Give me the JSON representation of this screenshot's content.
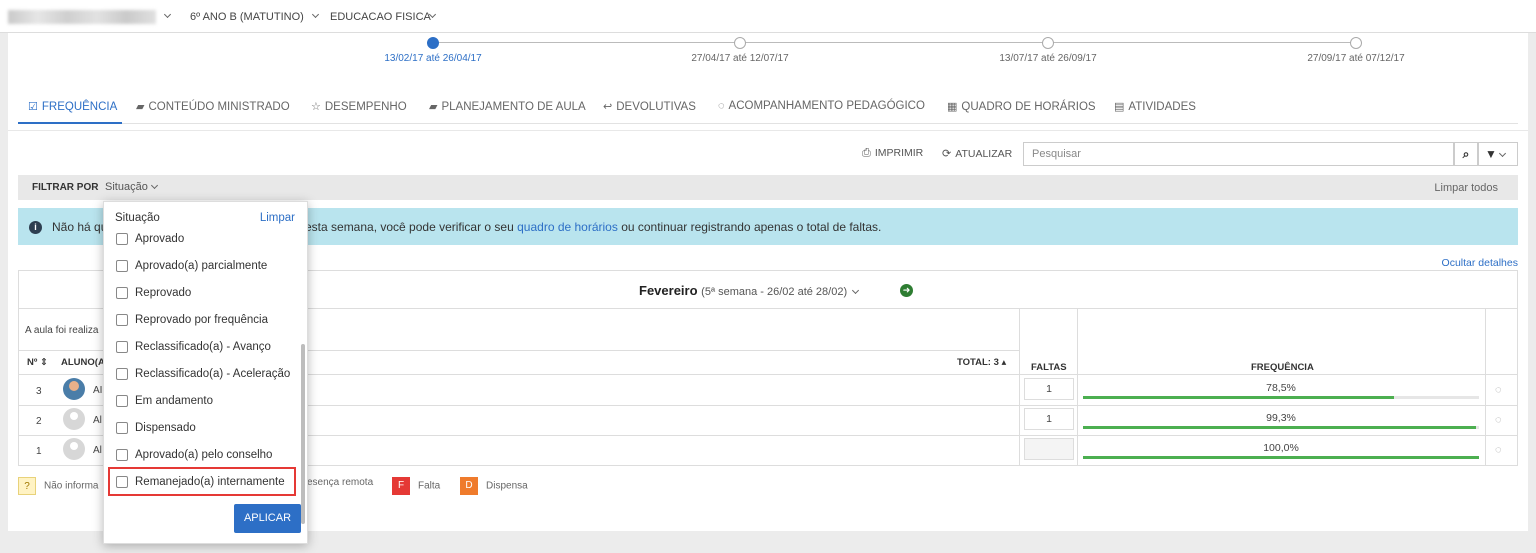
{
  "topbar": {
    "school_select": "6º ANO B (MATUTINO)",
    "subject_select": "EDUCACAO FISICA"
  },
  "timeline": [
    {
      "label": "13/02/17 até 26/04/17",
      "active": true
    },
    {
      "label": "27/04/17 até 12/07/17",
      "active": false
    },
    {
      "label": "13/07/17 até 26/09/17",
      "active": false
    },
    {
      "label": "27/09/17 até 07/12/17",
      "active": false
    }
  ],
  "tabs": [
    {
      "label": "FREQUÊNCIA",
      "icon": "check-square-icon"
    },
    {
      "label": "CONTEÚDO MINISTRADO",
      "icon": "book-icon"
    },
    {
      "label": "DESEMPENHO",
      "icon": "star-icon"
    },
    {
      "label": "PLANEJAMENTO DE AULA",
      "icon": "book-icon"
    },
    {
      "label": "DEVOLUTIVAS",
      "icon": "reply-icon"
    },
    {
      "label": "ACOMPANHAMENTO PEDAGÓGICO",
      "icon": "comment-icon"
    },
    {
      "label": "QUADRO DE HORÁRIOS",
      "icon": "calendar-icon"
    },
    {
      "label": "ATIVIDADES",
      "icon": "file-icon"
    }
  ],
  "toolbar": {
    "print": "IMPRIMIR",
    "refresh": "ATUALIZAR",
    "search_placeholder": "Pesquisar"
  },
  "filter": {
    "label": "FILTRAR POR",
    "situation": "Situação",
    "clear_all": "Limpar todos"
  },
  "info": {
    "prefix": "Não há qu",
    "text_before": "esta semana, você pode verificar o seu ",
    "link": "quadro de horários",
    "text_after": " ou continuar registrando apenas o total de faltas."
  },
  "hide_details": "Ocultar detalhes",
  "table": {
    "month": "Fevereiro",
    "week": "(5ª semana - 26/02 até 28/02)",
    "aula_text": "A aula foi realiza",
    "col_n": "Nº",
    "col_student": "ALUNO(A",
    "total": "TOTAL: 3",
    "col_faltas": "FALTAS",
    "col_freq": "FREQUÊNCIA",
    "rows": [
      {
        "n": "3",
        "name": "AI",
        "faltas": "1",
        "freq": "78,5%",
        "freq_value": 0.785,
        "avatar": "photo"
      },
      {
        "n": "2",
        "name": "Al",
        "faltas": "1",
        "freq": "99,3%",
        "freq_value": 0.993,
        "avatar": "generic"
      },
      {
        "n": "1",
        "name": "Al",
        "faltas": "",
        "freq": "100,0%",
        "freq_value": 1.0,
        "avatar": "generic"
      }
    ]
  },
  "legend": [
    {
      "code": "?",
      "label": "Não informa",
      "color": "#fff3c4"
    },
    {
      "code": "",
      "label": "esença remota",
      "color": ""
    },
    {
      "code": "F",
      "label": "Falta",
      "color": "#e53935"
    },
    {
      "code": "D",
      "label": "Dispensa",
      "color": "#ef7b2c"
    }
  ],
  "dropdown": {
    "title": "Situação",
    "clear": "Limpar",
    "options": [
      "Aprovado",
      "Aprovado(a) parcialmente",
      "Reprovado",
      "Reprovado por frequência",
      "Reclassificado(a) - Avanço",
      "Reclassificado(a) - Aceleração",
      "Em andamento",
      "Dispensado",
      "Aprovado(a) pelo conselho",
      "Remanejado(a) internamente"
    ],
    "highlighted": "Remanejado(a) internamente",
    "apply": "APLICAR"
  },
  "colors": {
    "accent": "#2d6fc6",
    "info_bg": "#b9e4ee",
    "bar": "#4caf50",
    "highlight": "#e53935"
  }
}
